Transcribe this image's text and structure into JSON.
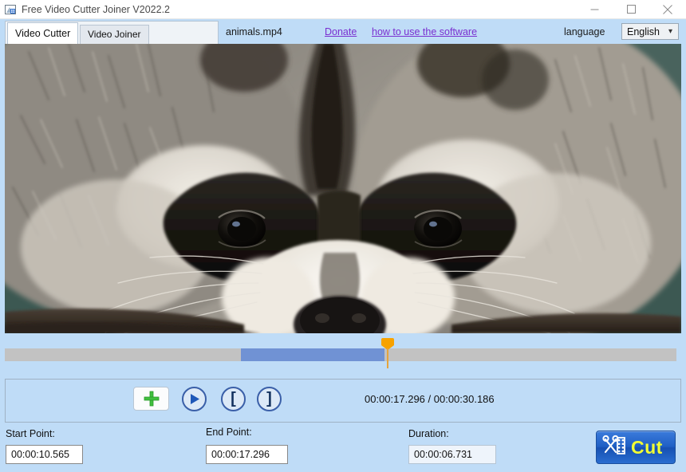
{
  "window": {
    "title": "Free Video Cutter Joiner V2022.2",
    "icon": "app-icon",
    "controls": {
      "minimize": "minimize",
      "maximize": "maximize",
      "close": "close"
    }
  },
  "toolbar": {
    "tabs": [
      {
        "label": "Video Cutter",
        "active": true
      },
      {
        "label": "Video Joiner",
        "active": false
      }
    ],
    "filename": "animals.mp4",
    "donate_label": "Donate",
    "howto_label": "how to use the software",
    "language_label": "language",
    "language_value": "English",
    "language_options": [
      "English"
    ],
    "chevron": "∨"
  },
  "video": {
    "description": "close-up of a raccoon face resting on a log",
    "alt": "raccoon-preview-frame"
  },
  "timeline": {
    "selection_start_pct": 35.2,
    "selection_end_pct": 56.5,
    "playhead_pct": 57.3
  },
  "controls": {
    "add_button": "add-file",
    "play_button": "play",
    "set_start_button": "[",
    "set_end_button": "]",
    "time_display": "00:00:17.296 / 00:00:30.186",
    "current_time": "00:00:17.296",
    "total_time": "00:00:30.186"
  },
  "fields": {
    "start_label": "Start Point:",
    "start_value": "00:00:10.565",
    "end_label": "End Point:",
    "end_value": "00:00:17.296",
    "duration_label": "Duration:",
    "duration_value": "00:00:06.731"
  },
  "cut": {
    "label": "Cut",
    "icon": "scissors-film-icon"
  },
  "colors": {
    "panel_bg": "#bfdcf7",
    "timeline_track": "#c2c2c2",
    "timeline_selection": "#7092d4",
    "playhead": "#f7a200",
    "link": "#7a2fd0",
    "cut_text": "#f2ff33",
    "cut_bg": "#1f5fc4"
  }
}
